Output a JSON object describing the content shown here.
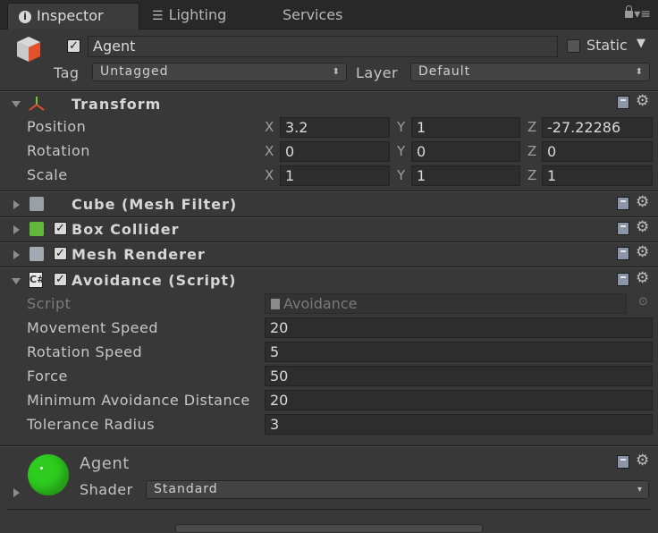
{
  "tabs": [
    {
      "label": "Inspector",
      "icon": "info-icon",
      "active": true
    },
    {
      "label": "Lighting",
      "icon": "lighting-icon",
      "active": false
    },
    {
      "label": "Services",
      "icon": "",
      "active": false
    }
  ],
  "object": {
    "name": "Agent",
    "active": true,
    "static_label": "Static",
    "static": false,
    "tag_label": "Tag",
    "tag_value": "Untagged",
    "layer_label": "Layer",
    "layer_value": "Default"
  },
  "transform": {
    "title": "Transform",
    "rows": [
      {
        "label": "Position",
        "x": "3.2",
        "y": "1",
        "z": "-27.22286"
      },
      {
        "label": "Rotation",
        "x": "0",
        "y": "0",
        "z": "0"
      },
      {
        "label": "Scale",
        "x": "1",
        "y": "1",
        "z": "1"
      }
    ],
    "axis_labels": {
      "x": "X",
      "y": "Y",
      "z": "Z"
    }
  },
  "components": {
    "mesh_filter": "Cube (Mesh Filter)",
    "box_collider": "Box Collider",
    "mesh_renderer": "Mesh Renderer",
    "avoidance": "Avoidance (Script)"
  },
  "avoidance": {
    "script_label": "Script",
    "script_value": "Avoidance",
    "fields": [
      {
        "label": "Movement Speed",
        "value": "20"
      },
      {
        "label": "Rotation Speed",
        "value": "5"
      },
      {
        "label": "Force",
        "value": "50"
      },
      {
        "label": "Minimum Avoidance Distance",
        "value": "20"
      },
      {
        "label": "Tolerance Radius",
        "value": "3"
      }
    ]
  },
  "material": {
    "name": "Agent",
    "shader_label": "Shader",
    "shader_value": "Standard",
    "preview_color": "#2ecc1f"
  },
  "colors": {
    "background": "#383838",
    "field_bg": "#2d2d2d",
    "tab_bar": "#282828"
  }
}
